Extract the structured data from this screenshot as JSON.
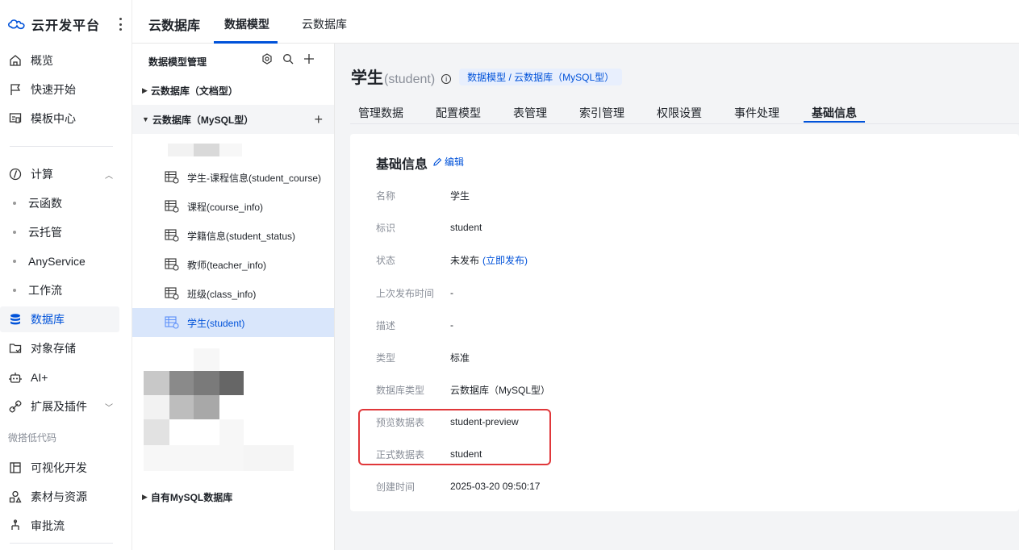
{
  "nav": {
    "brand": "云开发平台",
    "items": [
      {
        "label": "概览",
        "icon": "home-icon"
      },
      {
        "label": "快速开始",
        "icon": "flag-icon"
      },
      {
        "label": "模板中心",
        "icon": "template-icon"
      }
    ],
    "compute": {
      "label": "计算",
      "icon": "compute-icon"
    },
    "compute_children": [
      "云函数",
      "云托管",
      "AnyService",
      "工作流"
    ],
    "database": "数据库",
    "storage": "对象存储",
    "ai": "AI+",
    "extensions": "扩展及插件",
    "group_lowcode": "微搭低代码",
    "visual_dev": "可视化开发",
    "materials": "素材与资源",
    "approval": "审批流"
  },
  "topbar": {
    "title": "云数据库",
    "tabs": [
      "数据模型",
      "云数据库"
    ],
    "active_tab": "数据模型"
  },
  "tree": {
    "title": "数据模型管理",
    "groups": {
      "doc": "云数据库（文档型）",
      "mysql": "云数据库（MySQL型）",
      "own": "自有MySQL数据库"
    },
    "leaves": [
      "学生-课程信息(student_course)",
      "课程(course_info)",
      "学籍信息(student_status)",
      "教师(teacher_info)",
      "班级(class_info)",
      "学生(student)"
    ]
  },
  "page": {
    "title": "学生",
    "key": "(student)",
    "breadcrumb": "数据模型 / 云数据库（MySQL型）",
    "tabs": [
      "管理数据",
      "配置模型",
      "表管理",
      "索引管理",
      "权限设置",
      "事件处理",
      "基础信息"
    ],
    "active_tab": "基础信息"
  },
  "info": {
    "title": "基础信息",
    "edit": "编辑",
    "rows": [
      {
        "label": "名称",
        "value": "学生"
      },
      {
        "label": "标识",
        "value": "student"
      },
      {
        "label": "状态",
        "value": "未发布",
        "action": "(立即发布)"
      },
      {
        "label": "上次发布时间",
        "value": "-"
      },
      {
        "label": "描述",
        "value": "-"
      },
      {
        "label": "类型",
        "value": "标准"
      },
      {
        "label": "数据库类型",
        "value": "云数据库（MySQL型）"
      },
      {
        "label": "预览数据表",
        "value": "student-preview"
      },
      {
        "label": "正式数据表",
        "value": "student"
      },
      {
        "label": "创建时间",
        "value": "2025-03-20 09:50:17"
      }
    ]
  },
  "colors": {
    "accent": "#0052d9",
    "highlight_border": "#e0373a",
    "selected_bg": "#d9e6fb"
  }
}
